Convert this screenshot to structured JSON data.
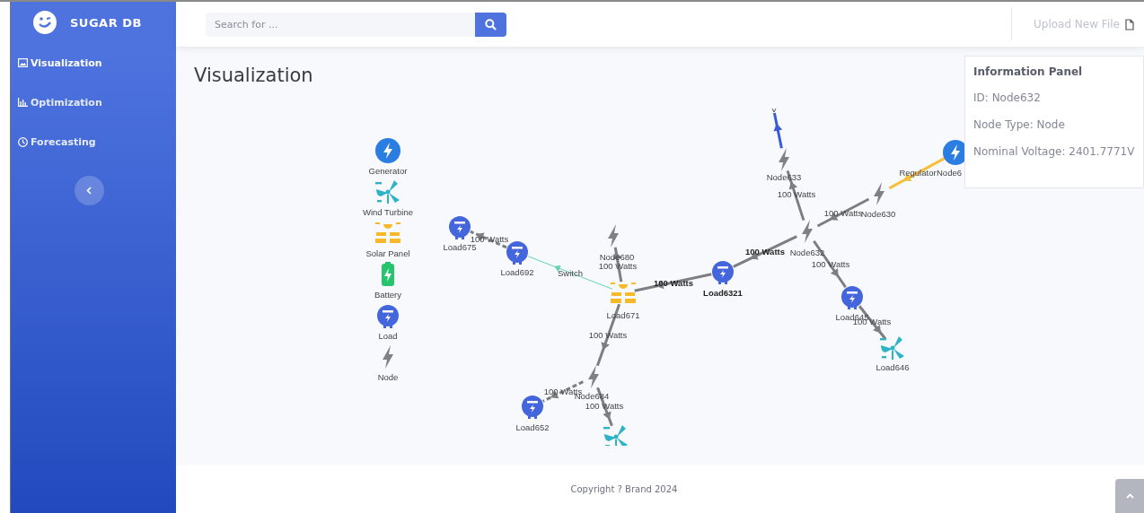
{
  "sidebar": {
    "brand": "SUGAR DB",
    "items": [
      {
        "label": "Visualization",
        "selected": true
      },
      {
        "label": "Optimization",
        "selected": false
      },
      {
        "label": "Forecasting",
        "selected": false
      }
    ]
  },
  "topbar": {
    "search": {
      "placeholder": "Search for ..."
    },
    "upload": "Upload New File"
  },
  "page": {
    "title": "Visualization"
  },
  "diagram": {
    "legend": [
      {
        "label": "Generator",
        "kind": "generator"
      },
      {
        "label": "Wind Turbine",
        "kind": "wind"
      },
      {
        "label": "Solar Panel",
        "kind": "solar"
      },
      {
        "label": "Battery",
        "kind": "battery"
      },
      {
        "label": "Load",
        "kind": "load"
      },
      {
        "label": "Node",
        "kind": "node"
      }
    ],
    "nodes": [
      {
        "kind": "terminal"
      },
      {
        "label": "Node633",
        "kind": "node"
      },
      {
        "label": "Node632",
        "kind": "node"
      },
      {
        "label": "Node630",
        "kind": "node"
      },
      {
        "label": "Node6",
        "kind": "generator"
      },
      {
        "label": "Load6321",
        "kind": "load",
        "bold": true
      },
      {
        "label": "Load645",
        "kind": "load"
      },
      {
        "label": "Load646",
        "kind": "wind"
      },
      {
        "label": "Load671",
        "kind": "solar"
      },
      {
        "label": "Node680",
        "kind": "node"
      },
      {
        "label": "Load692",
        "kind": "load"
      },
      {
        "label": "Load675",
        "kind": "load"
      },
      {
        "label": "Node684",
        "kind": "node"
      },
      {
        "label": "Load652",
        "kind": "load"
      },
      {
        "kind": "wind"
      }
    ],
    "edges": [
      {
        "kind": "feeder"
      },
      {
        "kind": "line",
        "label": "100 Watts"
      },
      {
        "kind": "line",
        "label": "100 Watts"
      },
      {
        "kind": "regulator",
        "label": "Regulator"
      },
      {
        "kind": "line",
        "label": "100 Watts",
        "bold": true
      },
      {
        "kind": "line",
        "label": "100 Watts"
      },
      {
        "kind": "line",
        "label": "100 Watts"
      },
      {
        "kind": "line",
        "label": "100 Watts",
        "bold": true
      },
      {
        "kind": "line",
        "label": "100 Watts"
      },
      {
        "kind": "switch",
        "label": "Switch"
      },
      {
        "kind": "line",
        "label": "100 Watts",
        "dashed": true
      },
      {
        "kind": "line",
        "label": "100 Watts"
      },
      {
        "kind": "line",
        "label": "100 Watts",
        "dashed": true
      },
      {
        "kind": "line",
        "label": "100 Watts"
      }
    ]
  },
  "info_panel": {
    "title": "Information Panel",
    "lines": [
      "ID: Node632",
      "Node Type: Node",
      "Nominal Voltage: 2401.7771V"
    ]
  },
  "footer": {
    "copyright": "Copyright ? Brand 2024"
  }
}
